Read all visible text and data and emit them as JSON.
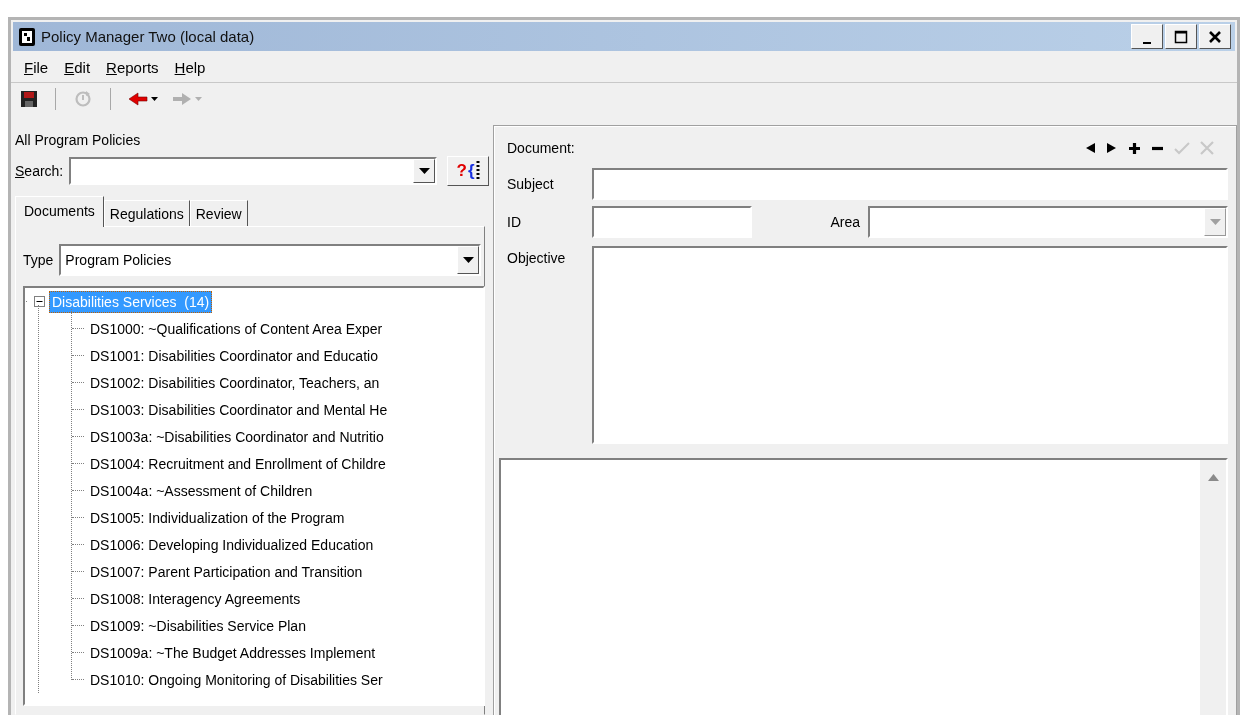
{
  "window": {
    "title": "Policy Manager Two (local data)",
    "controls": [
      {
        "kind": "minimize"
      },
      {
        "kind": "maximize"
      },
      {
        "kind": "close"
      }
    ]
  },
  "menu": [
    {
      "label": "File"
    },
    {
      "label": "Edit"
    },
    {
      "label": "Reports"
    },
    {
      "label": "Help"
    }
  ],
  "toolbar": [
    {
      "kind": "save",
      "disabled": false
    },
    {
      "kind": "separator"
    },
    {
      "kind": "refresh",
      "disabled": true
    },
    {
      "kind": "separator"
    },
    {
      "kind": "back",
      "disabled": false
    },
    {
      "kind": "forward",
      "disabled": true
    }
  ],
  "left_panel": {
    "title": "All Program Policies",
    "search": {
      "label": "Search:"
    },
    "search_help": {
      "label": "?{"
    },
    "tabs": [
      {
        "label": "Documents",
        "selected": true
      },
      {
        "label": "Regulations",
        "selected": false
      },
      {
        "label": "Review",
        "selected": false
      }
    ],
    "type": {
      "label": "Type",
      "value": "Program Policies"
    },
    "tree": [
      {
        "label": "Disabilities Services  (14)",
        "selected": true,
        "expanded": true,
        "children": [
          {
            "label": "DS1000: ~Qualifications of Content Area Exper",
            "selected": false
          },
          {
            "label": "DS1001: Disabilities Coordinator and Educatio",
            "selected": false
          },
          {
            "label": "DS1002: Disabilities Coordinator, Teachers, an",
            "selected": false
          },
          {
            "label": "DS1003: Disabilities Coordinator and Mental He",
            "selected": false
          },
          {
            "label": "DS1003a: ~Disabilities Coordinator and Nutritio",
            "selected": false
          },
          {
            "label": "DS1004: Recruitment and Enrollment of Childre",
            "selected": false
          },
          {
            "label": "DS1004a: ~Assessment of Children",
            "selected": false
          },
          {
            "label": "DS1005: Individualization of the Program",
            "selected": false
          },
          {
            "label": "DS1006: Developing Individualized Education",
            "selected": false
          },
          {
            "label": "DS1007: Parent Participation and Transition",
            "selected": false
          },
          {
            "label": "DS1008: Interagency Agreements",
            "selected": false
          },
          {
            "label": "DS1009: ~Disabilities Service Plan",
            "selected": false
          },
          {
            "label": "DS1009a: ~The Budget Addresses Implement",
            "selected": false
          },
          {
            "label": "DS1010: Ongoing Monitoring of Disabilities Ser",
            "selected": false
          }
        ]
      }
    ]
  },
  "document": {
    "label": "Document:",
    "tools": [
      {
        "kind": "previous",
        "disabled": false
      },
      {
        "kind": "next",
        "disabled": false
      },
      {
        "kind": "add",
        "disabled": false
      },
      {
        "kind": "remove",
        "disabled": false
      },
      {
        "kind": "accept",
        "disabled": true
      },
      {
        "kind": "cancel",
        "disabled": true
      }
    ],
    "subject": {
      "label": "Subject"
    },
    "id": {
      "label": "ID"
    },
    "area": {
      "label": "Area",
      "disabled": true
    },
    "objective": {
      "label": "Objective"
    }
  }
}
